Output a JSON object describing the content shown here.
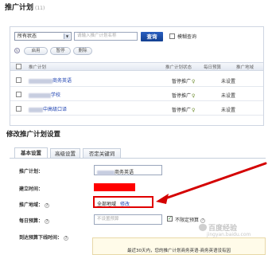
{
  "page_title": "推广计划",
  "page_title_count": "(11)",
  "filter": {
    "status_value": "所有状态",
    "search_placeholder": "请输入推广计划名称",
    "search_button": "查询",
    "fuzzy_label": "模糊查询"
  },
  "actions": {
    "enable": "启用",
    "pause": "暂停",
    "delete": "删除"
  },
  "table": {
    "columns": [
      "推广计划",
      "推广计划状态",
      "每日预算",
      "推广地域"
    ],
    "rows": [
      {
        "name_suffix": "商务英语",
        "status": "暂停推广",
        "budget": "未设置"
      },
      {
        "name_suffix": "学校",
        "status": "暂停推广",
        "budget": "未设置"
      },
      {
        "name_suffix": "中高级口译",
        "status": "暂停推广",
        "budget": "未设置"
      }
    ]
  },
  "settings": {
    "title": "修改推广计划设置",
    "tabs": [
      "基本设置",
      "高级设置",
      "否定关键词"
    ],
    "form": {
      "plan_label": "推广计划：",
      "plan_value_suffix": "商务英语",
      "created_label": "建立时间：",
      "region_label": "推广地域：",
      "region_value": "全部地域",
      "region_edit": "修改",
      "budget_label": "每日预算：",
      "budget_placeholder": "不设置预算",
      "budget_check_label": "不限定预算",
      "offline_label": "到达预算下线时间："
    },
    "note": "最近30天内，您的推广计划商务英语-商务英语没有因"
  },
  "watermark": {
    "text": "百度经验",
    "url": "jingyan.baidu.com"
  },
  "colors": {
    "link": "#1a3fb0",
    "search_button": "#1d4ea6",
    "highlight": "#e00000"
  }
}
